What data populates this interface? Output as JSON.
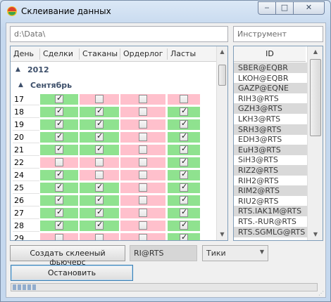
{
  "window": {
    "title": "Склеивание данных",
    "buttons": {
      "minimize": "‒",
      "maximize": "□",
      "close": "✕"
    }
  },
  "path_field": {
    "value": "d:\\Data\\"
  },
  "instrument_field": {
    "placeholder": "Инструмент"
  },
  "grid": {
    "columns": [
      "День",
      "Сделки",
      "Стаканы",
      "Ордерлог",
      "Ласты"
    ],
    "year": "2012",
    "month": "Сентябрь",
    "rows": [
      {
        "day": "17",
        "cells": [
          [
            "g",
            true
          ],
          [
            "p",
            false
          ],
          [
            "p",
            false
          ],
          [
            "p",
            false
          ]
        ]
      },
      {
        "day": "18",
        "cells": [
          [
            "g",
            true
          ],
          [
            "g",
            true
          ],
          [
            "p",
            false
          ],
          [
            "g",
            true
          ]
        ]
      },
      {
        "day": "19",
        "cells": [
          [
            "g",
            true
          ],
          [
            "g",
            true
          ],
          [
            "p",
            false
          ],
          [
            "g",
            true
          ]
        ]
      },
      {
        "day": "20",
        "cells": [
          [
            "g",
            true
          ],
          [
            "g",
            true
          ],
          [
            "p",
            false
          ],
          [
            "g",
            true
          ]
        ]
      },
      {
        "day": "21",
        "cells": [
          [
            "g",
            true
          ],
          [
            "g",
            true
          ],
          [
            "p",
            false
          ],
          [
            "g",
            true
          ]
        ]
      },
      {
        "day": "22",
        "cells": [
          [
            "p",
            false
          ],
          [
            "p",
            false
          ],
          [
            "p",
            false
          ],
          [
            "g",
            true
          ]
        ]
      },
      {
        "day": "24",
        "cells": [
          [
            "g",
            true
          ],
          [
            "p",
            false
          ],
          [
            "p",
            false
          ],
          [
            "g",
            true
          ]
        ]
      },
      {
        "day": "25",
        "cells": [
          [
            "g",
            true
          ],
          [
            "g",
            true
          ],
          [
            "p",
            false
          ],
          [
            "g",
            true
          ]
        ]
      },
      {
        "day": "26",
        "cells": [
          [
            "g",
            true
          ],
          [
            "g",
            true
          ],
          [
            "p",
            false
          ],
          [
            "g",
            true
          ]
        ]
      },
      {
        "day": "27",
        "cells": [
          [
            "g",
            true
          ],
          [
            "g",
            true
          ],
          [
            "p",
            false
          ],
          [
            "g",
            true
          ]
        ]
      },
      {
        "day": "28",
        "cells": [
          [
            "g",
            true
          ],
          [
            "g",
            true
          ],
          [
            "p",
            false
          ],
          [
            "g",
            true
          ]
        ]
      },
      {
        "day": "29",
        "cells": [
          [
            "p",
            false
          ],
          [
            "p",
            false
          ],
          [
            "p",
            false
          ],
          [
            "g",
            true
          ]
        ]
      }
    ]
  },
  "id_list": {
    "header": "ID",
    "items": [
      "SBER@EQBR",
      "LKOH@EQBR",
      "GAZP@EQNE",
      "RIH3@RTS",
      "GZH3@RTS",
      "LKH3@RTS",
      "SRH3@RTS",
      "EDH3@RTS",
      "EuH3@RTS",
      "SiH3@RTS",
      "RIZ2@RTS",
      "RIH2@RTS",
      "RIM2@RTS",
      "RIU2@RTS",
      "RTS.IAK1M@RTS",
      "RTS.-RUR@RTS",
      "RTS.SGMLG@RTS"
    ]
  },
  "create_button": {
    "label": "Создать склееный фьючерс"
  },
  "result_field": {
    "value": "RI@RTS"
  },
  "type_select": {
    "value": "Тики"
  },
  "stop_button": {
    "label": "Остановить"
  },
  "colors": {
    "green": "#8fe28f",
    "pink": "#ffc0cc",
    "accent": "#3c7fb1"
  }
}
